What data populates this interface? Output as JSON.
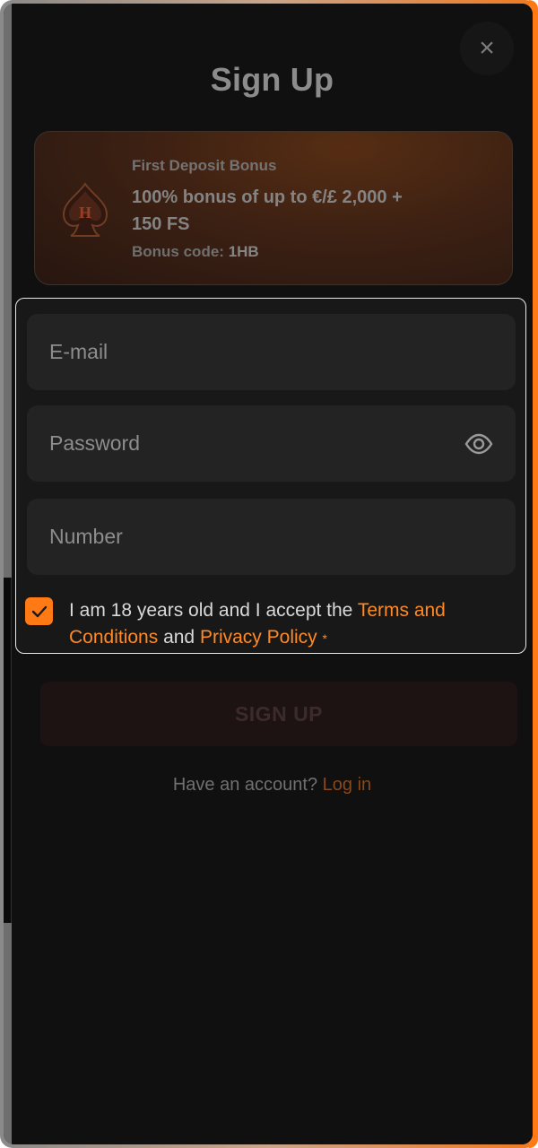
{
  "modal": {
    "title": "Sign Up",
    "close_label": "×"
  },
  "bonus": {
    "label": "First Deposit Bonus",
    "offer": "100% bonus of up to €/£ 2,000 + 150 FS",
    "code_label": "Bonus code:",
    "code_value": "1HB",
    "icon": "spade-logo-icon"
  },
  "form": {
    "email_placeholder": "E-mail",
    "email_value": "",
    "password_placeholder": "Password",
    "password_value": "",
    "number_placeholder": "Number",
    "number_value": "",
    "consent": {
      "checked": true,
      "text_before": "I am 18 years old and I accept the ",
      "terms_link": "Terms and Conditions",
      "text_middle": " and ",
      "privacy_link": "Privacy Policy",
      "required_mark": "*"
    }
  },
  "actions": {
    "signup_label": "SIGN UP",
    "have_account_text": "Have an account?",
    "login_link": "Log in"
  },
  "colors": {
    "accent": "#ff7a14",
    "background": "#101010",
    "field": "#232323"
  }
}
